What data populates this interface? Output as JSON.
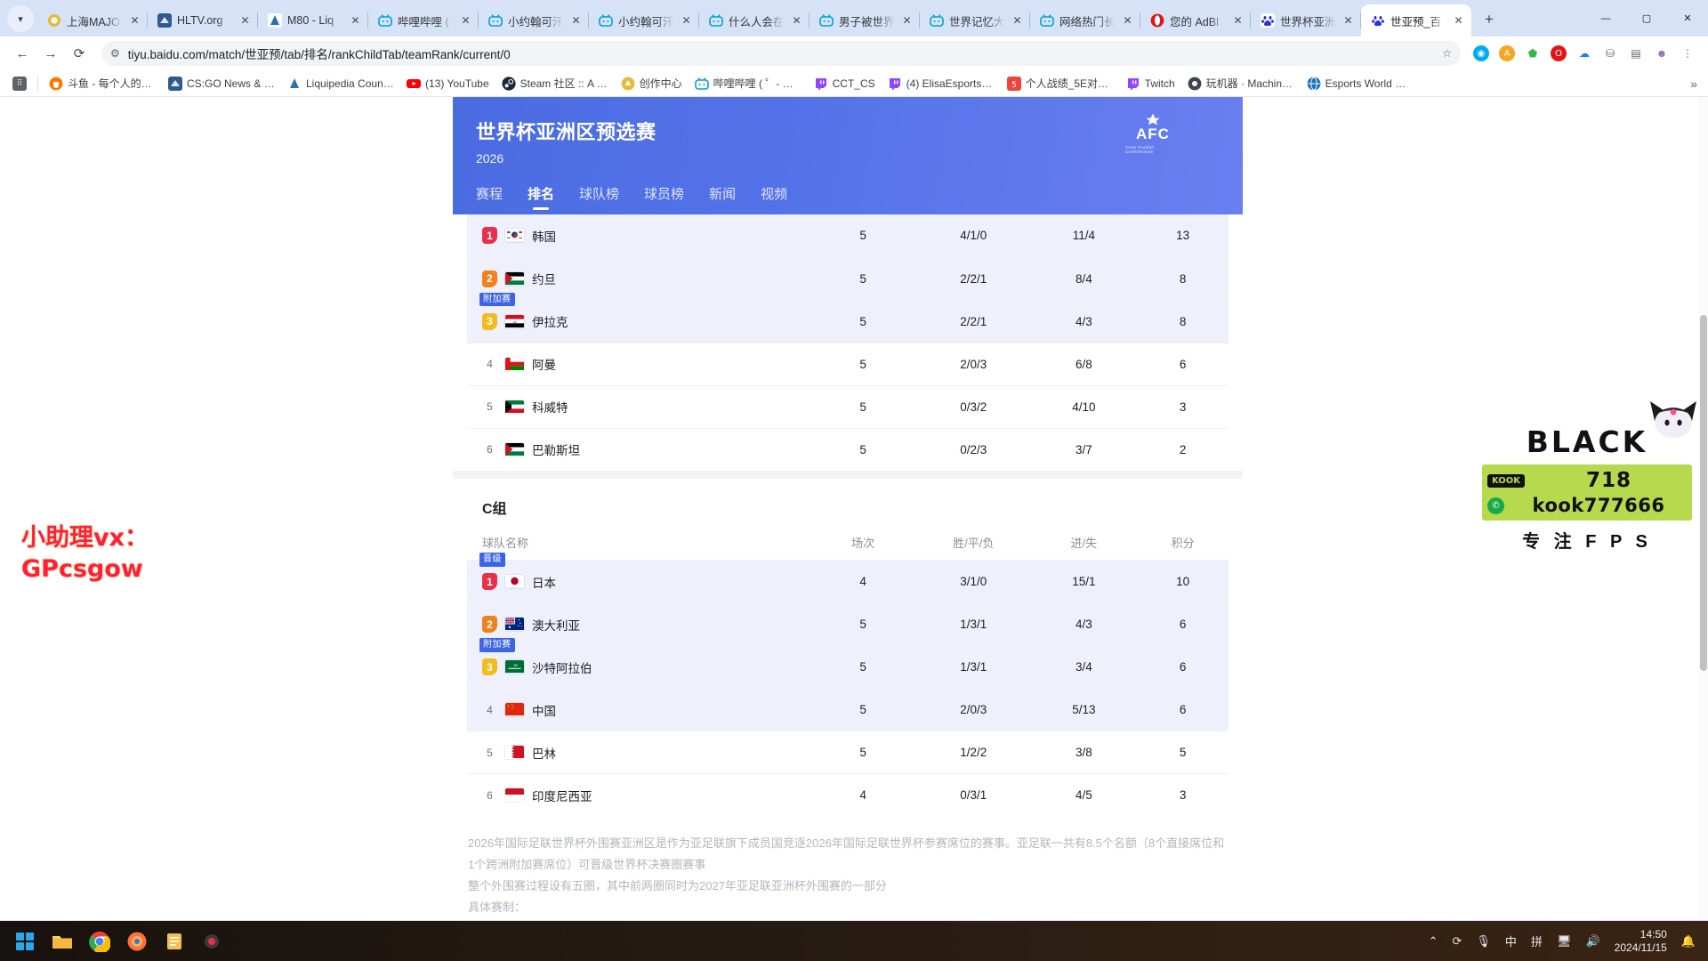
{
  "browser": {
    "tab_list_icon": "chevron-down-icon",
    "tabs": [
      {
        "label": "上海MAJO",
        "icon": "lion-icon",
        "color": "#e8b93a",
        "active": false
      },
      {
        "label": "HLTV.org",
        "icon": "hltv-icon",
        "color": "#2d5b8e",
        "active": false
      },
      {
        "label": "M80 - Liq",
        "icon": "liquipedia-icon",
        "color": "#ffffff",
        "active": false
      },
      {
        "label": "哔哩哔哩 (",
        "icon": "bilibili-icon",
        "color": "#00a1d6",
        "active": false
      },
      {
        "label": "小约翰可汗",
        "icon": "bilibili-icon",
        "color": "#00a1d6",
        "active": false
      },
      {
        "label": "小约翰可汗",
        "icon": "bilibili-icon",
        "color": "#00a1d6",
        "active": false
      },
      {
        "label": "什么人会在",
        "icon": "bilibili-icon",
        "color": "#00a1d6",
        "active": false
      },
      {
        "label": "男子被世界",
        "icon": "bilibili-icon",
        "color": "#00a1d6",
        "active": false
      },
      {
        "label": "世界记忆大",
        "icon": "bilibili-icon",
        "color": "#00a1d6",
        "active": false
      },
      {
        "label": "网络热门长",
        "icon": "bilibili-icon",
        "color": "#00a1d6",
        "active": false
      },
      {
        "label": "您的 AdBl",
        "icon": "opera-icon",
        "color": "#e01616",
        "active": false
      },
      {
        "label": "世界杯亚洲",
        "icon": "baidu-icon",
        "color": "#2932e1",
        "active": false
      },
      {
        "label": "世亚预_百",
        "icon": "baidu-icon",
        "color": "#2932e1",
        "active": true
      }
    ],
    "new_tab_label": "+",
    "window_controls": [
      "—",
      "▢",
      "✕"
    ],
    "nav": {
      "back": "←",
      "forward": "→",
      "reload": "⟳"
    },
    "omnibox": {
      "site_info_icon": "site-settings-icon",
      "url": "tiyu.baidu.com/match/世亚预/tab/排名/rankChildTab/teamRank/current/0",
      "star_icon": "bookmark-star-icon"
    },
    "extensions": [
      {
        "name": "tampermonkey-icon",
        "glyph": "◉",
        "color": "#00adef"
      },
      {
        "name": "adguard-icon",
        "glyph": "A",
        "color": "#f5a623"
      },
      {
        "name": "shield-extension-icon",
        "glyph": "⬟",
        "color": "#3ab54a"
      },
      {
        "name": "opera-extension-icon",
        "glyph": "O",
        "color": "#e01616"
      },
      {
        "name": "bluesky-extension-icon",
        "glyph": "☁",
        "color": "#1185fe"
      },
      {
        "name": "puzzle-extensions-icon",
        "glyph": "⛁",
        "color": "#5f6368"
      },
      {
        "name": "sidepanel-icon",
        "glyph": "▤",
        "color": "#5f6368"
      },
      {
        "name": "profile-avatar-icon",
        "glyph": "☻",
        "color": "#8e6ba8"
      },
      {
        "name": "chrome-menu-icon",
        "glyph": "⋮",
        "color": "#5f6368"
      }
    ],
    "bookmarks": {
      "apps_icon": "apps-grid-icon",
      "items": [
        {
          "label": "斗鱼 - 每个人的直...",
          "icon": "douyu-icon",
          "color": "#ff7700"
        },
        {
          "label": "CS:GO News & Co...",
          "icon": "hltv-icon",
          "color": "#2d5b8e"
        },
        {
          "label": "Liquipedia Counte...",
          "icon": "liquipedia-icon",
          "color": "#2f6fb0"
        },
        {
          "label": "(13) YouTube",
          "icon": "youtube-icon",
          "color": "#ff0000"
        },
        {
          "label": "Steam 社区 :: A de...",
          "icon": "steam-icon",
          "color": "#1b2838"
        },
        {
          "label": "创作中心",
          "icon": "bilibili-creator-icon",
          "color": "#e8b93a"
        },
        {
          "label": "哔哩哔哩 ( ゜- ゜)つ...",
          "icon": "bilibili-icon",
          "color": "#00a1d6"
        },
        {
          "label": "CCT_CS",
          "icon": "twitch-icon",
          "color": "#9146ff"
        },
        {
          "label": "(4) ElisaEsports - T...",
          "icon": "twitch-icon",
          "color": "#9146ff"
        },
        {
          "label": "个人战绩_5E对战平...",
          "icon": "5e-icon",
          "color": "#e8453c"
        },
        {
          "label": "Twitch",
          "icon": "twitch-icon",
          "color": "#9146ff"
        },
        {
          "label": "玩机器 · Machine...",
          "icon": "machine-icon",
          "color": "#444b55"
        },
        {
          "label": "Esports World Ra...",
          "icon": "esports-world-icon",
          "color": "#1b6ec2"
        }
      ],
      "overflow_icon": "double-chevron-icon"
    }
  },
  "page": {
    "hero": {
      "title": "世界杯亚洲区预选赛",
      "season": "2026",
      "logo_text": "AFC",
      "logo_subtext": "Asian Football Confederation"
    },
    "nav_tabs": [
      {
        "label": "赛程",
        "active": false
      },
      {
        "label": "排名",
        "active": true
      },
      {
        "label": "球队榜",
        "active": false
      },
      {
        "label": "球员榜",
        "active": false
      },
      {
        "label": "新闻",
        "active": false
      },
      {
        "label": "视频",
        "active": false
      }
    ],
    "columns": [
      "球队名称",
      "场次",
      "胜/平/负",
      "进/失",
      "积分"
    ],
    "groups": [
      {
        "name": "",
        "show_header": false,
        "rows": [
          {
            "pos": "1",
            "badge": "",
            "team": "韩国",
            "flag": "kr",
            "played": "5",
            "wdl": "4/1/0",
            "gf_ga": "11/4",
            "points": "13",
            "highlight": true
          },
          {
            "pos": "2",
            "badge": "",
            "team": "约旦",
            "flag": "jo",
            "played": "5",
            "wdl": "2/2/1",
            "gf_ga": "8/4",
            "points": "8",
            "highlight": true
          },
          {
            "pos": "3",
            "badge": "附加赛",
            "team": "伊拉克",
            "flag": "iq",
            "played": "5",
            "wdl": "2/2/1",
            "gf_ga": "4/3",
            "points": "8",
            "highlight": true
          },
          {
            "pos": "4",
            "badge": "",
            "team": "阿曼",
            "flag": "om",
            "played": "5",
            "wdl": "2/0/3",
            "gf_ga": "6/8",
            "points": "6",
            "highlight": false
          },
          {
            "pos": "5",
            "badge": "",
            "team": "科威特",
            "flag": "kw",
            "played": "5",
            "wdl": "0/3/2",
            "gf_ga": "4/10",
            "points": "3",
            "highlight": false
          },
          {
            "pos": "6",
            "badge": "",
            "team": "巴勒斯坦",
            "flag": "ps",
            "played": "5",
            "wdl": "0/2/3",
            "gf_ga": "3/7",
            "points": "2",
            "highlight": false
          }
        ]
      },
      {
        "name": "C组",
        "show_header": true,
        "rows": [
          {
            "pos": "1",
            "badge": "晋级",
            "team": "日本",
            "flag": "jp",
            "played": "4",
            "wdl": "3/1/0",
            "gf_ga": "15/1",
            "points": "10",
            "highlight": true
          },
          {
            "pos": "2",
            "badge": "",
            "team": "澳大利亚",
            "flag": "au",
            "played": "5",
            "wdl": "1/3/1",
            "gf_ga": "4/3",
            "points": "6",
            "highlight": true
          },
          {
            "pos": "3",
            "badge": "附加赛",
            "team": "沙特阿拉伯",
            "flag": "sa",
            "played": "5",
            "wdl": "1/3/1",
            "gf_ga": "3/4",
            "points": "6",
            "highlight": true
          },
          {
            "pos": "4",
            "badge": "",
            "team": "中国",
            "flag": "cn",
            "played": "5",
            "wdl": "2/0/3",
            "gf_ga": "5/13",
            "points": "6",
            "highlight": true
          },
          {
            "pos": "5",
            "badge": "",
            "team": "巴林",
            "flag": "bh",
            "played": "5",
            "wdl": "1/2/2",
            "gf_ga": "3/8",
            "points": "5",
            "highlight": false
          },
          {
            "pos": "6",
            "badge": "",
            "team": "印度尼西亚",
            "flag": "id",
            "played": "4",
            "wdl": "0/3/1",
            "gf_ga": "4/5",
            "points": "3",
            "highlight": false
          }
        ]
      }
    ],
    "notes": [
      "2026年国际足联世界杯外围赛亚洲区是作为亚足联旗下成员国竞逐2026年国际足联世界杯参赛席位的赛事。亚足联一共有8.5个名额（8个直接席位和1个跨洲附加赛席位）可晋级世界杯决赛圈赛事",
      "整个外围赛过程设有五圈，其中前两圈同时为2027年亚足联亚洲杯外围赛的一部分",
      "具体赛制："
    ]
  },
  "watermarks": {
    "left": {
      "line1": "小助理vx：",
      "line2": "GPcsgow"
    },
    "right": {
      "brand": "BLACK",
      "chip_label": "KOOK",
      "number": "718",
      "kook_id": "kook777666",
      "tagline": "专 注 F P S"
    }
  },
  "taskbar": {
    "icons": [
      "start-icon",
      "file-explorer-icon",
      "chrome-icon",
      "firefox-icon",
      "notepad-icon",
      "recorder-icon"
    ],
    "tray": [
      {
        "name": "show-hidden-icons",
        "glyph": "⌃"
      },
      {
        "name": "sync-icon",
        "glyph": "⟳"
      },
      {
        "name": "microphone-icon",
        "glyph": "🎤"
      },
      {
        "name": "ime-chinese-icon",
        "glyph": "中"
      },
      {
        "name": "ime-pinyin-icon",
        "glyph": "拼"
      },
      {
        "name": "network-icon",
        "glyph": "🖧"
      },
      {
        "name": "volume-icon",
        "glyph": "🔊"
      }
    ],
    "time": "14:50",
    "date": "2024/11/15",
    "notification_icon": "bell-icon"
  }
}
